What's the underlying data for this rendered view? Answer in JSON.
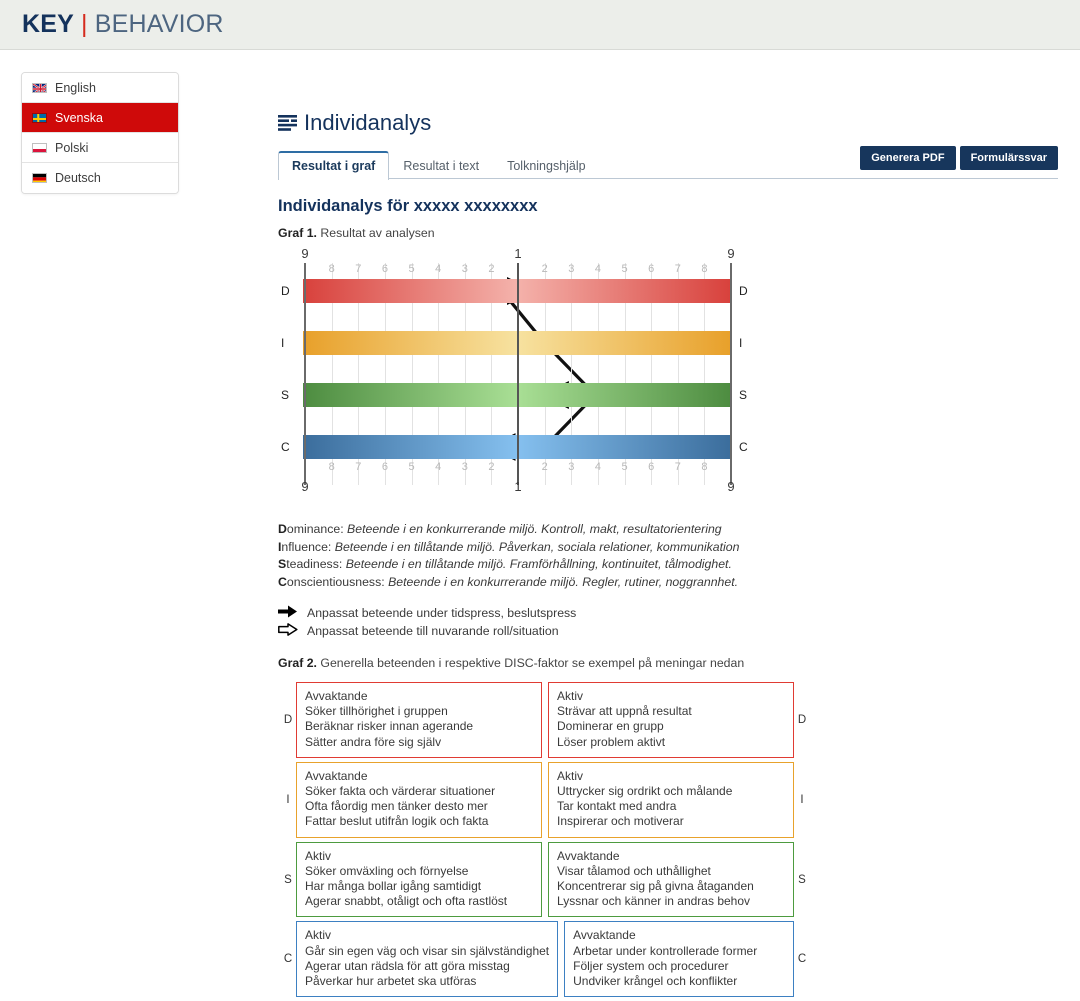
{
  "brand": {
    "key": "KEY",
    "divider": "|",
    "behavior": "BEHAVIOR"
  },
  "sidebar": {
    "items": [
      {
        "label": "English",
        "flag": "gb-flag-icon",
        "active": false
      },
      {
        "label": "Svenska",
        "flag": "se-flag-icon",
        "active": true
      },
      {
        "label": "Polski",
        "flag": "pl-flag-icon",
        "active": false
      },
      {
        "label": "Deutsch",
        "flag": "de-flag-icon",
        "active": false
      }
    ]
  },
  "main": {
    "page_title": "Individanalys",
    "tabs": [
      {
        "label": "Resultat i graf",
        "active": true
      },
      {
        "label": "Resultat i text",
        "active": false
      },
      {
        "label": "Tolkningshjälp",
        "active": false
      }
    ],
    "buttons": [
      {
        "label": "Generera PDF"
      },
      {
        "label": "Formulärssvar"
      }
    ],
    "analysis_title": "Individanalys för xxxxx xxxxxxxx",
    "graf1_bold": "Graf 1.",
    "graf1_rest": " Resultat av analysen",
    "graf2_bold": "Graf 2.",
    "graf2_rest": " Generella beteenden i respektive DISC-faktor se exempel på meningar nedan"
  },
  "descriptions": [
    {
      "lead": "D",
      "rest": "ominance: ",
      "italic": "Beteende i en konkurrerande miljö. Kontroll, makt, resultatorientering"
    },
    {
      "lead": "I",
      "rest": "nfluence: ",
      "italic": "Beteende i en tillåtande miljö. Påverkan, sociala relationer, kommunikation"
    },
    {
      "lead": "S",
      "rest": "teadiness: ",
      "italic": "Beteende i en tillåtande miljö. Framförhållning, kontinuitet, tålmodighet."
    },
    {
      "lead": "C",
      "rest": "onscientiousness: ",
      "italic": "Beteende i en konkurrerande miljö. Regler, rutiner, noggrannhet."
    }
  ],
  "arrow_key": [
    {
      "icon": "solid-arrow-icon",
      "label": "Anpassat beteende under tidspress, beslutspress"
    },
    {
      "icon": "outline-arrow-icon",
      "label": "Anpassat beteende till nuvarande roll/situation"
    }
  ],
  "chart_data": {
    "type": "line",
    "title": "Graf 1. Resultat av analysen",
    "categories": [
      "D",
      "I",
      "S",
      "C"
    ],
    "axis_labels_top": [
      "9",
      "8",
      "7",
      "6",
      "5",
      "4",
      "3",
      "2",
      "1",
      "2",
      "3",
      "4",
      "5",
      "6",
      "7",
      "8",
      "9"
    ],
    "axis_labels_bottom": [
      "9",
      "8",
      "7",
      "6",
      "5",
      "4",
      "3",
      "2",
      "1",
      "2",
      "3",
      "4",
      "5",
      "6",
      "7",
      "8",
      "9"
    ],
    "xlabel": "",
    "ylabel": "",
    "xlim": [
      -8,
      8
    ],
    "grid": true,
    "center_value": 1,
    "band_colors": {
      "D": "#d8413c",
      "I": "#e8a02a",
      "S": "#4d8c40",
      "C": "#3b6d9c"
    },
    "series": [
      {
        "name": "Anpassat beteende under tidspress, beslutspress",
        "marker": "solid-arrow-icon",
        "arrow_color": "#000000",
        "values": [
          {
            "factor": "D",
            "point_x": -0.6,
            "arrow_dir": "right",
            "arrow_to": 0.4
          },
          {
            "factor": "I",
            "point_x": 1.0,
            "arrow_dir": "none",
            "arrow_to": 1.0
          },
          {
            "factor": "S",
            "point_x": 2.9,
            "arrow_dir": "left",
            "arrow_to": 1.1
          },
          {
            "factor": "C",
            "point_x": 1.0,
            "arrow_dir": "left",
            "arrow_to": -0.9
          }
        ]
      },
      {
        "name": "Anpassat beteende till nuvarande roll/situation",
        "marker": "outline-arrow-icon",
        "arrow_color": "#ffffff",
        "values": [
          {
            "factor": "D",
            "point_x": -0.6,
            "arrow_dir": "left",
            "arrow_to": -1.9
          },
          {
            "factor": "I",
            "point_x": 1.0,
            "arrow_dir": "left",
            "arrow_to": 0.1
          },
          {
            "factor": "S",
            "point_x": 2.9,
            "arrow_dir": "right",
            "arrow_to": 3.8
          },
          {
            "factor": "C",
            "point_x": 1.0,
            "arrow_dir": "right",
            "arrow_to": 3.6
          }
        ]
      }
    ],
    "markers": [
      {
        "factor": "D",
        "x": -0.6
      },
      {
        "factor": "I",
        "x": 1.0
      },
      {
        "factor": "S",
        "x": 2.9
      },
      {
        "factor": "C",
        "x": 1.0
      }
    ]
  },
  "graf2": {
    "rows": [
      {
        "letter": "D",
        "left": {
          "title": "Avvaktande",
          "lines": [
            "Söker tillhörighet i gruppen",
            "Beräknar risker innan agerande",
            "Sätter andra före sig själv"
          ]
        },
        "right": {
          "title": "Aktiv",
          "lines": [
            "Strävar att uppnå resultat",
            "Dominerar en grupp",
            "Löser problem aktivt"
          ]
        }
      },
      {
        "letter": "I",
        "left": {
          "title": "Avvaktande",
          "lines": [
            "Söker fakta och värderar situationer",
            "Ofta fåordig men tänker desto mer",
            "Fattar beslut utifrån logik och fakta"
          ]
        },
        "right": {
          "title": "Aktiv",
          "lines": [
            "Uttrycker sig ordrikt och målande",
            "Tar kontakt med andra",
            "Inspirerar och motiverar"
          ]
        }
      },
      {
        "letter": "S",
        "left": {
          "title": "Aktiv",
          "lines": [
            "Söker omväxling och förnyelse",
            "Har många bollar igång samtidigt",
            "Agerar snabbt, otåligt och ofta rastlöst"
          ]
        },
        "right": {
          "title": "Avvaktande",
          "lines": [
            "Visar tålamod och uthållighet",
            "Koncentrerar sig på givna åtaganden",
            "Lyssnar och känner in andras behov"
          ]
        }
      },
      {
        "letter": "C",
        "left": {
          "title": "Aktiv",
          "lines": [
            "Går sin egen väg och visar sin självständighet",
            "Agerar utan rädsla för att göra misstag",
            "Påverkar hur arbetet ska utföras"
          ]
        },
        "right": {
          "title": "Avvaktande",
          "lines": [
            "Arbetar under kontrollerade former",
            "Följer system och procedurer",
            "Undviker krångel och konflikter"
          ]
        }
      }
    ]
  }
}
